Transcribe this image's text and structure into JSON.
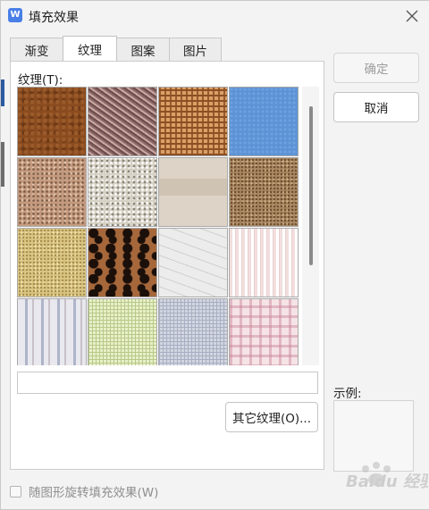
{
  "window": {
    "title": "填充效果",
    "app_icon_letter": "W"
  },
  "tabs": [
    {
      "label": "渐变"
    },
    {
      "label": "纹理"
    },
    {
      "label": "图案"
    },
    {
      "label": "图片"
    }
  ],
  "texture_panel": {
    "label": "纹理(T):",
    "swatches": [
      {
        "name": "brown-leather"
      },
      {
        "name": "woven-mat"
      },
      {
        "name": "burlap-weave"
      },
      {
        "name": "blue-paper"
      },
      {
        "name": "tan-granite"
      },
      {
        "name": "gray-terrazzo"
      },
      {
        "name": "beige-stripes"
      },
      {
        "name": "brown-sand"
      },
      {
        "name": "gold-sand"
      },
      {
        "name": "leopard-print"
      },
      {
        "name": "office-sketch-paper"
      },
      {
        "name": "pink-pleats"
      },
      {
        "name": "blue-stripe-fabric"
      },
      {
        "name": "green-grid"
      },
      {
        "name": "gray-check"
      },
      {
        "name": "pink-plaid"
      }
    ],
    "texture_name_value": "",
    "more_textures_button": "其它纹理(O)..."
  },
  "actions": {
    "ok": "确定",
    "cancel": "取消"
  },
  "preview": {
    "label": "示例:"
  },
  "bottom": {
    "rotate_with_shape_label": "随图形旋转填充效果(W)",
    "rotate_with_shape_checked": false
  },
  "watermark": {
    "text": "Baidu 经验"
  },
  "colors": {
    "accent": "#4a7fe8",
    "panel_bg": "#ffffff",
    "window_bg": "#f3f3f3"
  }
}
